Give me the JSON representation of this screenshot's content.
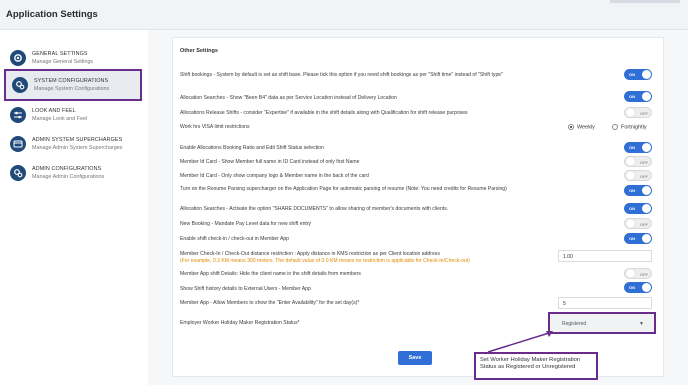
{
  "app": {
    "title": "Application Settings"
  },
  "sidebar": {
    "items": [
      {
        "title": "GENERAL SETTINGS",
        "subtitle": "Manage General Settings",
        "icon": "gear-icon"
      },
      {
        "title": "SYSTEM CONFIGURATIONS",
        "subtitle": "Manage System Configurations",
        "icon": "gears-icon"
      },
      {
        "title": "LOOK AND FEEL",
        "subtitle": "Manage Look and Feel",
        "icon": "sliders-icon"
      },
      {
        "title": "ADMIN SYSTEM SUPERCHARGES",
        "subtitle": "Manage Admin System Supercharges",
        "icon": "card-icon"
      },
      {
        "title": "ADMIN CONFIGURATIONS",
        "subtitle": "Manage Admin Configurations",
        "icon": "gears-icon"
      }
    ],
    "active_index": 1
  },
  "card": {
    "title": "Other Settings"
  },
  "settings": [
    {
      "label": "Shift bookings - System by default is set as shift base. Please tick this option if you need shift bookings as per \"Shift time\" instead of \"Shift type\"",
      "control": "toggle",
      "state": "ON"
    },
    {
      "label": "Allocation Searches - Show \"Been B4\" data as per Service Location instead of Delivery Location",
      "control": "toggle",
      "state": "ON"
    },
    {
      "label": "Allocations Release Shifts - consider \"Expertise\" if available in the shift details along with Qualification for shift release purposes",
      "control": "toggle",
      "state": "OFF"
    },
    {
      "label": "Work hrs VISA limit restrictions",
      "control": "radio",
      "options": [
        "Weekly",
        "Fortnightly"
      ],
      "selected": "Weekly"
    },
    {
      "label": "Enable Allocations Booking Ratio and Edit Shift Status selection",
      "control": "toggle",
      "state": "ON"
    },
    {
      "label": "Member Id Card - Show Member full name in ID Card instead of only first Name",
      "control": "toggle",
      "state": "OFF"
    },
    {
      "label": "Member Id Card - Only show company logo & Member name in the back of the card",
      "control": "toggle",
      "state": "OFF"
    },
    {
      "label": "Turn on the Resume Parsing supercharger on the Application Page for automatic parsing of resume (Note: You need credits for Resume Parsing)",
      "control": "toggle",
      "state": "ON"
    },
    {
      "label": "Allocation Searches - Activate the option \"SHARE DOCUMENTS\" to allow sharing of member's documents with clients.",
      "control": "toggle",
      "state": "ON"
    },
    {
      "label": "New Booking - Mandate Pay Level data for new shift entry",
      "control": "toggle",
      "state": "OFF"
    },
    {
      "label": "Enable shift check-in / check-out in Member App",
      "control": "toggle",
      "state": "ON"
    },
    {
      "label": "Member Check-In / Check-Out distance restriction : Apply distance in KMS restriction as per Client location address",
      "hint": "(For example, 0.3 KM means 300 meters. The default value of 0.0 KM means no restriction is applicable for Check-In/Check-out)",
      "control": "text",
      "value": "1.00"
    },
    {
      "label": "Member App shift Details: Hide the client name in the shift details from members",
      "control": "toggle",
      "state": "OFF"
    },
    {
      "label": "Show Shift history details to External Users - Member App",
      "control": "toggle",
      "state": "ON"
    },
    {
      "label": "Member App - Allow Members to show the \"Enter Availability\" for the set day(s)*",
      "control": "text",
      "value": "5"
    },
    {
      "label": "Employer Worker Holiday Maker Registration Status*",
      "control": "select",
      "value": "Registered"
    }
  ],
  "save_label": "Save",
  "callout": {
    "text": "Set Worker Holiday Maker Registration Status as Registered or Unregistered"
  },
  "colors": {
    "accent": "#2f6fd6",
    "highlight": "#6a2c8c",
    "hint": "#e08a00",
    "icon": "#1f4a7a"
  }
}
